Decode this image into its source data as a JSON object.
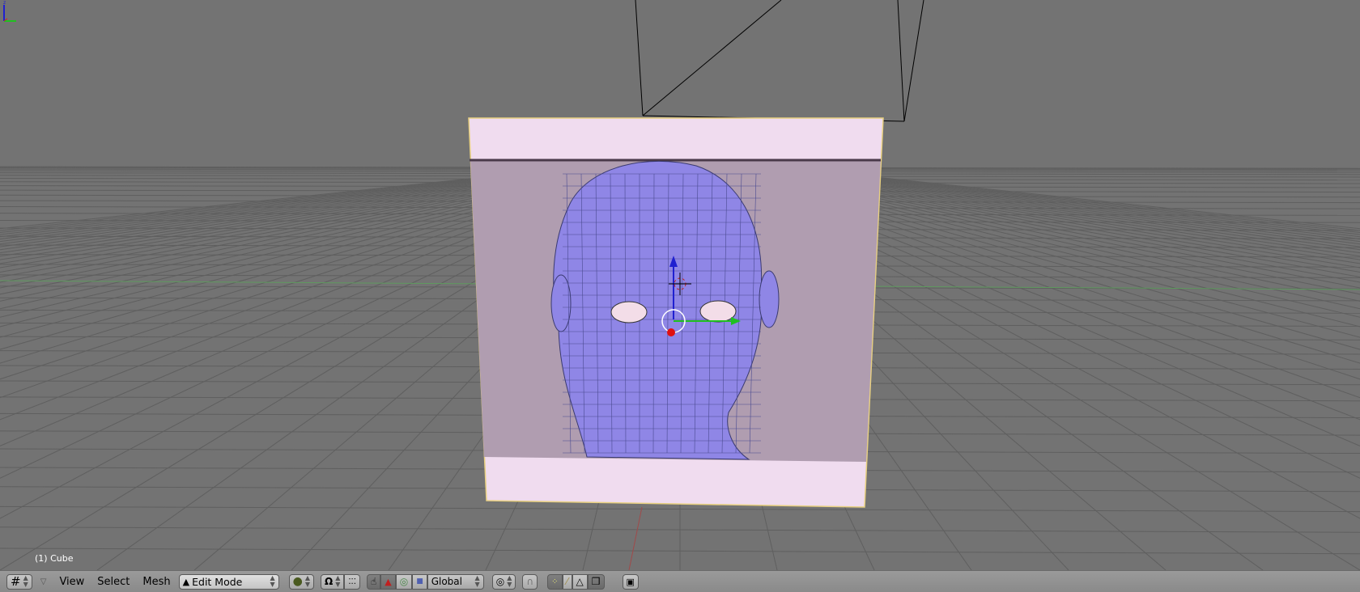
{
  "viewport": {
    "object_label": "(1) Cube",
    "colors": {
      "background": "#737373",
      "grid": "#5f5f5f",
      "x_axis": "#a04a4a",
      "y_axis": "#5f9a5f",
      "face_band": "#f0dcef",
      "image_bg": "#b09db0",
      "head": "#8f86e6"
    }
  },
  "header": {
    "editor_type_icon": "grid-icon",
    "menus": [
      "View",
      "Select",
      "Mesh"
    ],
    "mode": "Edit Mode",
    "orientation": "Global",
    "icons": [
      "shading-icon",
      "pivot-icon",
      "manipulator-icon",
      "translate-icon",
      "rotate-icon",
      "scale-icon",
      "proportional-icon",
      "snap-magnet-icon",
      "vertex-select-icon",
      "edge-select-icon",
      "face-select-icon",
      "occlude-icon",
      "render-icon"
    ]
  }
}
